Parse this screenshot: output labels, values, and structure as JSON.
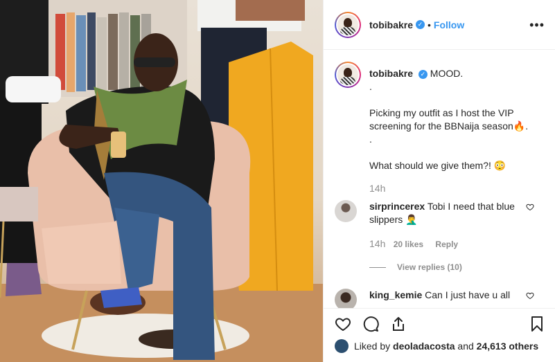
{
  "post": {
    "username": "tobibakre",
    "follow_label": "Follow",
    "separator": "•",
    "more_label": "•••"
  },
  "caption": {
    "username": "tobibakre",
    "lines": [
      "MOOD.",
      ".",
      "Picking my outfit as I host the VIP screening for the BBNaija season🔥.",
      ".",
      "What should we give them?! 😳"
    ],
    "time": "14h"
  },
  "comments": [
    {
      "username": "sirprincerex",
      "text": "Tobi I need that blue slippers 🤦‍♂️",
      "time": "14h",
      "likes": "20 likes",
      "reply_label": "Reply",
      "view_replies": "View replies (10)"
    },
    {
      "username": "king_kemie",
      "text": "Can I just have u all"
    }
  ],
  "likes": {
    "prefix": "Liked by",
    "user": "deoladacosta",
    "middle": "and",
    "others": "24,613 others"
  },
  "icons": {
    "verified": "✓",
    "like": "heart-icon",
    "comment": "comment-icon",
    "share": "share-icon",
    "save": "bookmark-icon"
  },
  "colors": {
    "accent": "#3897f0",
    "muted": "#8e8e8e",
    "text": "#262626"
  }
}
